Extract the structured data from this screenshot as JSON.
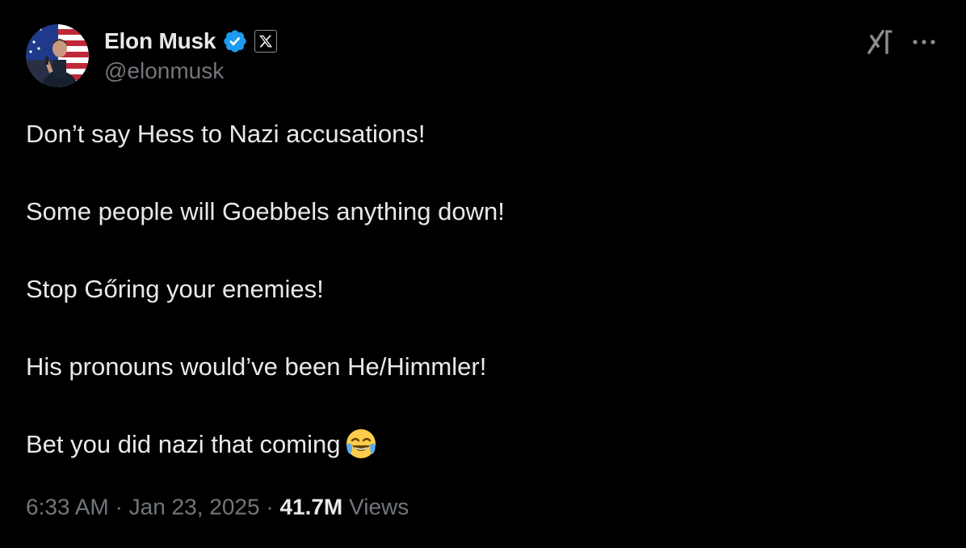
{
  "author": {
    "display_name": "Elon Musk",
    "handle": "@elonmusk",
    "verified_icon": "verified-badge-icon",
    "affiliate_icon": "x-logo-icon",
    "verified_color": "#1d9bf0"
  },
  "actions": {
    "grok_icon": "grok-icon",
    "more_icon": "more-options-icon"
  },
  "tweet": {
    "lines": [
      "Don’t say Hess to Nazi accusations!",
      "Some people will Goebbels anything down!",
      "Stop Gőring your enemies!",
      "His pronouns would’ve been He/Himmler!",
      "Bet you did nazi that coming"
    ],
    "emoji": "face-with-tears-of-joy"
  },
  "meta": {
    "time": "6:33 AM",
    "separator": "·",
    "date": "Jan 23, 2025",
    "views_count": "41.7M",
    "views_label": "Views"
  },
  "colors": {
    "background": "#000000",
    "primary_text": "#e7e9ea",
    "secondary_text": "#71767b"
  }
}
